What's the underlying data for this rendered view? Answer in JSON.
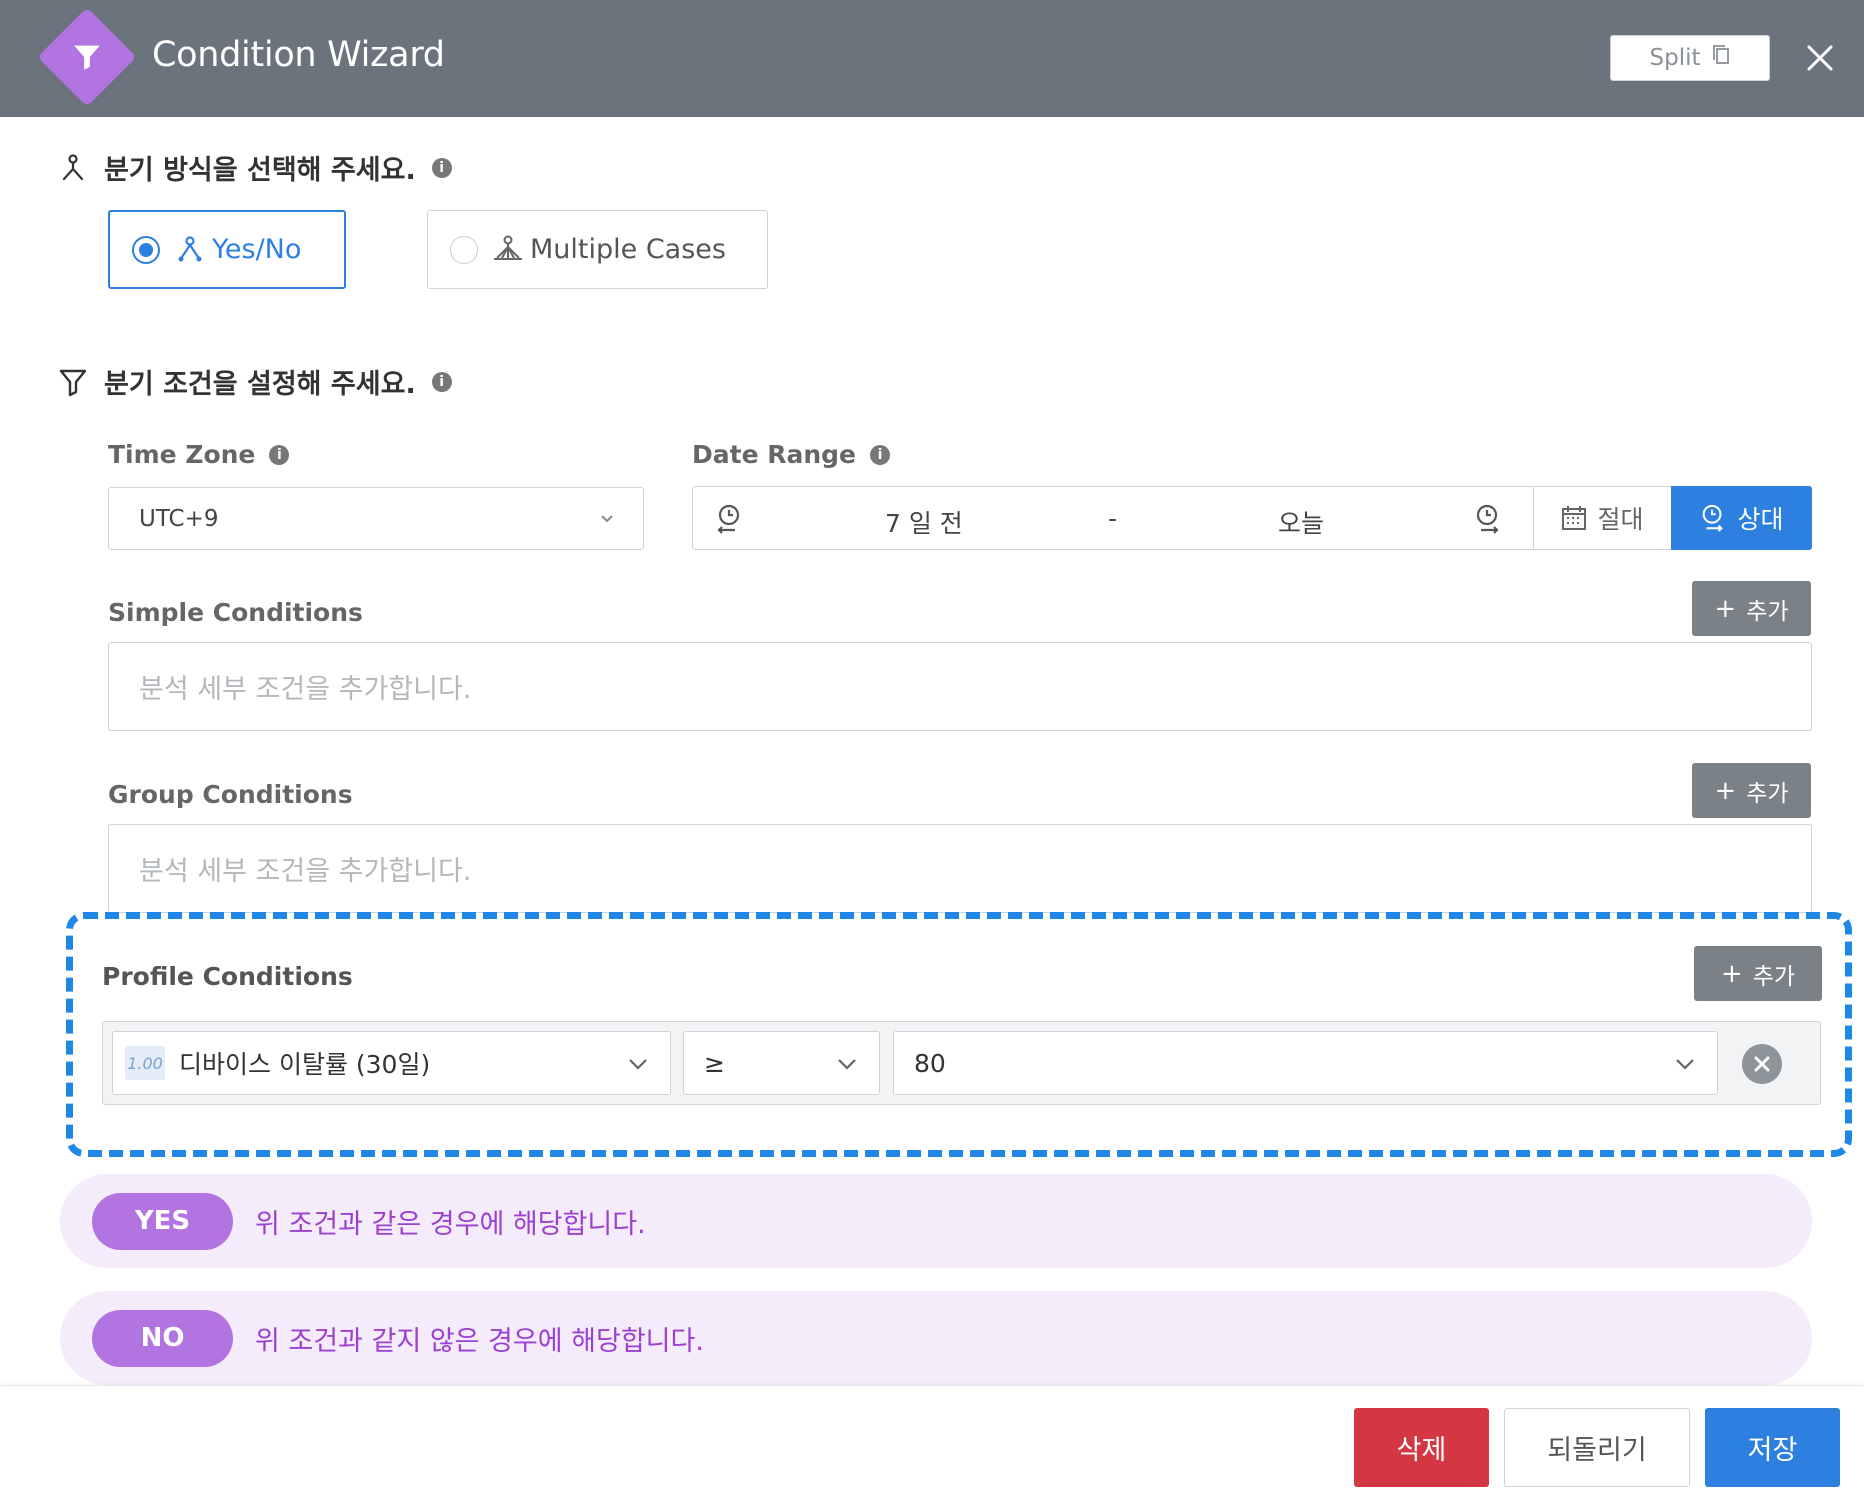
{
  "header": {
    "title": "Condition Wizard",
    "split_label": "Split"
  },
  "branch_method": {
    "heading": "분기 방식을 선택해 주세요.",
    "options": [
      {
        "label": "Yes/No",
        "selected": true
      },
      {
        "label": "Multiple Cases",
        "selected": false
      }
    ]
  },
  "branch_conditions": {
    "heading": "분기 조건을 설정해 주세요.",
    "time_zone": {
      "label": "Time Zone",
      "value": "UTC+9"
    },
    "date_range": {
      "label": "Date Range",
      "start": "7 일 전",
      "separator": "-",
      "end": "오늘",
      "absolute_label": "절대",
      "relative_label": "상대",
      "mode": "상대"
    },
    "simple": {
      "label": "Simple Conditions",
      "add_label": "추가",
      "placeholder": "분석 세부 조건을 추가합니다."
    },
    "group": {
      "label": "Group Conditions",
      "add_label": "추가",
      "placeholder": "분석 세부 조건을 추가합니다."
    },
    "profile": {
      "label": "Profile Conditions",
      "add_label": "추가",
      "row": {
        "type_badge": "1.00",
        "attribute": "디바이스 이탈률 (30일)",
        "operator": "≥",
        "value": "80"
      }
    }
  },
  "results": {
    "yes": {
      "pill": "YES",
      "text": "위 조건과 같은 경우에 해당합니다."
    },
    "no": {
      "pill": "NO",
      "text": "위 조건과 같지 않은 경우에 해당합니다."
    }
  },
  "footer": {
    "delete_label": "삭제",
    "undo_label": "되돌리기",
    "save_label": "저장"
  },
  "colors": {
    "accent": "#2d7fe0",
    "brand": "#b174e0",
    "danger": "#d33842",
    "header": "#6b747d",
    "highlight": "#1f87e5"
  }
}
